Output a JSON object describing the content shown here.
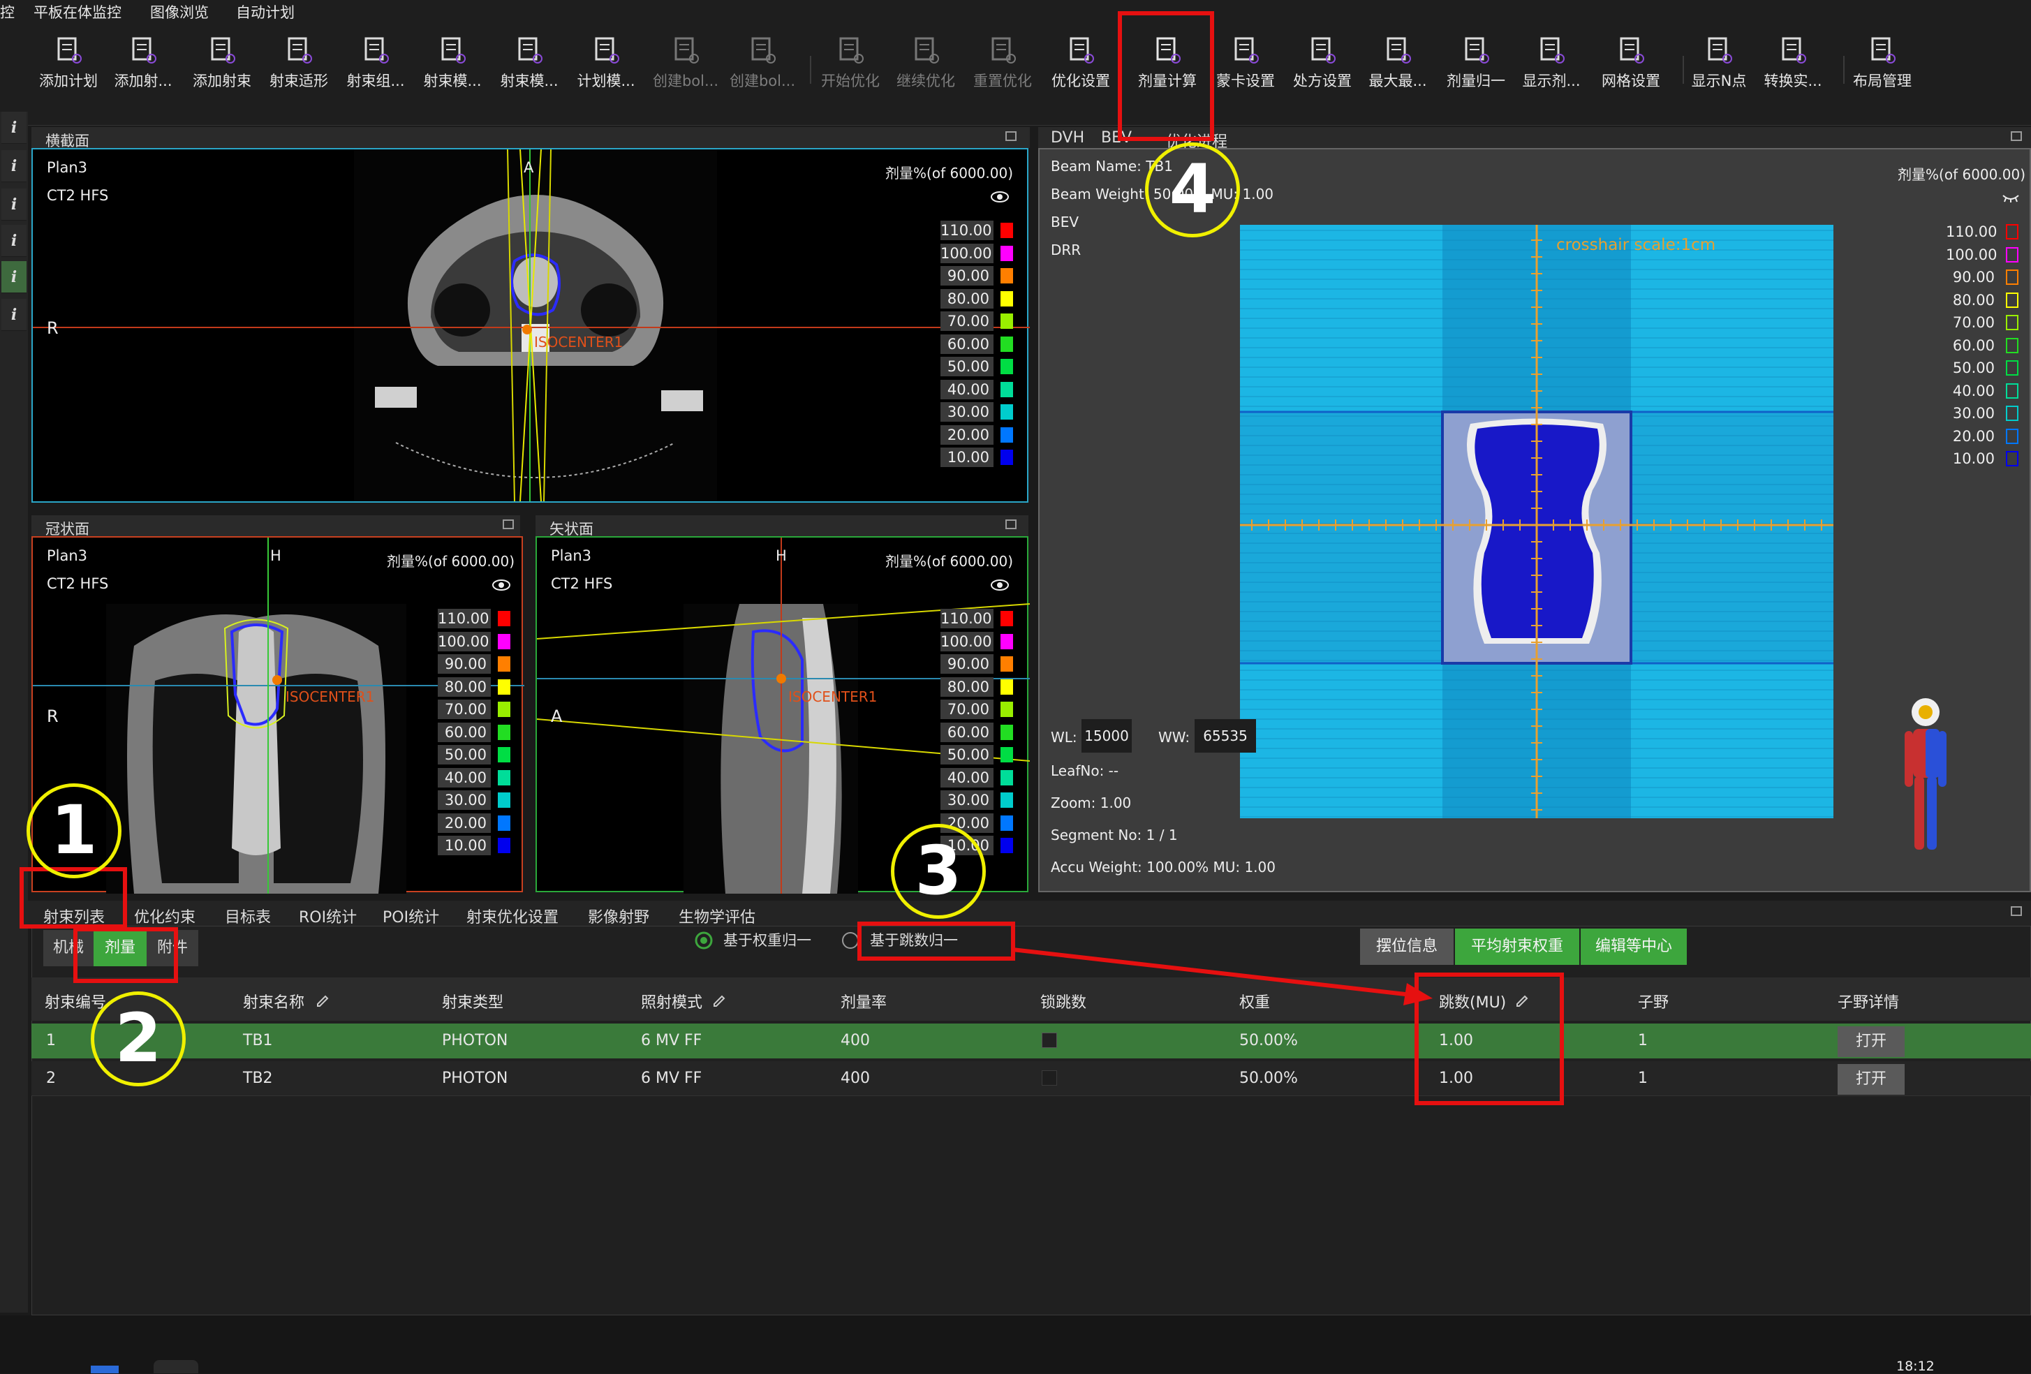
{
  "menu": [
    "控",
    "平板在体监控",
    "图像浏览",
    "自动计划"
  ],
  "toolbar": [
    {
      "label": "添加计划",
      "icon": "add-plan-icon"
    },
    {
      "label": "添加射...",
      "icon": "add-field-icon"
    },
    {
      "label": "添加射束",
      "icon": "add-beam-icon"
    },
    {
      "label": "射束适形",
      "icon": "beam-conform-icon"
    },
    {
      "label": "射束组...",
      "icon": "beam-group-icon"
    },
    {
      "label": "射束模...",
      "icon": "beam-template-icon"
    },
    {
      "label": "射束模...",
      "icon": "beam-template2-icon"
    },
    {
      "label": "计划模...",
      "icon": "plan-template-icon"
    },
    {
      "label": "创建bol...",
      "icon": "create-bolus-icon"
    },
    {
      "label": "创建bol...",
      "icon": "create-bolus2-icon"
    },
    {
      "label": "开始优化",
      "icon": "start-optimize-icon"
    },
    {
      "label": "继续优化",
      "icon": "continue-optimize-icon"
    },
    {
      "label": "重置优化",
      "icon": "reset-optimize-icon"
    },
    {
      "label": "优化设置",
      "icon": "optimize-settings-icon"
    },
    {
      "label": "剂量计算",
      "icon": "dose-calc-icon"
    },
    {
      "label": "蒙卡设置",
      "icon": "monte-carlo-icon"
    },
    {
      "label": "处方设置",
      "icon": "prescription-icon"
    },
    {
      "label": "最大最...",
      "icon": "max-min-icon"
    },
    {
      "label": "剂量归一",
      "icon": "dose-normalize-icon"
    },
    {
      "label": "显示剂...",
      "icon": "show-dose-icon"
    },
    {
      "label": "网格设置",
      "icon": "grid-settings-icon"
    },
    {
      "label": "显示N点",
      "icon": "show-n-points-icon"
    },
    {
      "label": "转换实...",
      "icon": "convert-icon"
    },
    {
      "label": "布局管理",
      "icon": "layout-icon"
    }
  ],
  "left_strip": [
    "i",
    "i",
    "i",
    "i",
    "i",
    "i"
  ],
  "axial": {
    "title": "横截面",
    "plan": "Plan3",
    "image": "CT2 HFS",
    "dose_header": "剂量%(of 6000.00)",
    "top": "A",
    "left": "R",
    "isocenter": "ISOCENTER1"
  },
  "coronal": {
    "title": "冠状面",
    "plan": "Plan3",
    "image": "CT2 HFS",
    "dose_header": "剂量%(of 6000.00)",
    "top": "H",
    "left": "R",
    "isocenter": "ISOCENTER1"
  },
  "sagittal": {
    "title": "矢状面",
    "plan": "Plan3",
    "image": "CT2 HFS",
    "dose_header": "剂量%(of 6000.00)",
    "top": "H",
    "left": "A",
    "isocenter": "ISOCENTER1"
  },
  "dose_legend": [
    {
      "value": "110.00",
      "color": "#ff0000"
    },
    {
      "value": "100.00",
      "color": "#ff00ff"
    },
    {
      "value": "90.00",
      "color": "#ff7f00"
    },
    {
      "value": "80.00",
      "color": "#ffff00"
    },
    {
      "value": "70.00",
      "color": "#99ee00"
    },
    {
      "value": "60.00",
      "color": "#22dd22"
    },
    {
      "value": "50.00",
      "color": "#00dd44"
    },
    {
      "value": "40.00",
      "color": "#00dd99"
    },
    {
      "value": "30.00",
      "color": "#00cccc"
    },
    {
      "value": "20.00",
      "color": "#0077ff"
    },
    {
      "value": "10.00",
      "color": "#0000ee"
    }
  ],
  "bev": {
    "tabs": [
      "DVH",
      "BEV",
      "优化进程"
    ],
    "beam_name": "Beam Name: TB1",
    "beam_weight": "Beam Weight: 50.00% MU: 1.00",
    "mode1": "BEV",
    "mode2": "DRR",
    "dose_header": "剂量%(of 6000.00)",
    "crosshair": "crosshair scale:1cm",
    "wl_label": "WL:",
    "wl_value": "15000",
    "ww_label": "WW:",
    "ww_value": "65535",
    "leaf": "LeafNo: --",
    "zoom": "Zoom: 1.00",
    "segment": "Segment No: 1 / 1",
    "accu": "Accu Weight: 100.00% MU: 1.00"
  },
  "bottom_tabs": [
    "射束列表",
    "优化约束",
    "目标表",
    "ROI统计",
    "POI统计",
    "射束优化设置",
    "影像射野",
    "生物学评估"
  ],
  "subtabs": [
    "机械",
    "剂量",
    "附件"
  ],
  "radio": {
    "weight": "基于权重归一",
    "mu": "基于跳数归一"
  },
  "action_buttons": [
    "摆位信息",
    "平均射束权重",
    "编辑等中心"
  ],
  "table": {
    "headers": [
      "射束编号",
      "射束名称",
      "射束类型",
      "照射模式",
      "剂量率",
      "锁跳数",
      "权重",
      "跳数(MU)",
      "子野",
      "子野详情"
    ],
    "rows": [
      {
        "id": "1",
        "name": "TB1",
        "type": "PHOTON",
        "mode": "6 MV FF",
        "rate": "400",
        "locked": true,
        "weight": "50.00%",
        "mu": "1.00",
        "segments": "1",
        "detail": "打开"
      },
      {
        "id": "2",
        "name": "TB2",
        "type": "PHOTON",
        "mode": "6 MV FF",
        "rate": "400",
        "locked": false,
        "weight": "50.00%",
        "mu": "1.00",
        "segments": "1",
        "detail": "打开"
      }
    ]
  },
  "annotations": [
    "1",
    "2",
    "3",
    "4"
  ],
  "clock": "18:12"
}
